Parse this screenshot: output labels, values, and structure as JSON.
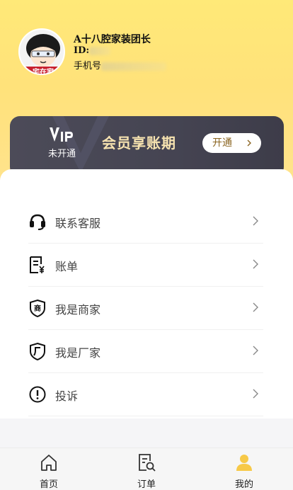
{
  "profile": {
    "name": "A十八腔家装团长",
    "id_label": "ID:",
    "phone_label": "手机号"
  },
  "vip": {
    "logo_text": "VIP",
    "status": "未开通",
    "title": "会员享账期",
    "button_label": "开通"
  },
  "menu": [
    {
      "label": "联系客服",
      "icon": "headset-icon"
    },
    {
      "label": "账单",
      "icon": "bill-icon"
    },
    {
      "label": "我是商家",
      "icon": "merchant-shield-icon"
    },
    {
      "label": "我是厂家",
      "icon": "factory-shield-icon"
    },
    {
      "label": "投诉",
      "icon": "alert-circle-icon"
    }
  ],
  "tabbar": [
    {
      "label": "首页",
      "icon": "home-icon",
      "active": false
    },
    {
      "label": "订单",
      "icon": "order-search-icon",
      "active": false
    },
    {
      "label": "我的",
      "icon": "user-icon",
      "active": true
    }
  ],
  "colors": {
    "header_yellow": "#ffe27a",
    "vip_card": "#46454f",
    "vip_title": "#f7e3b0",
    "active_tab": "#f7c948"
  }
}
